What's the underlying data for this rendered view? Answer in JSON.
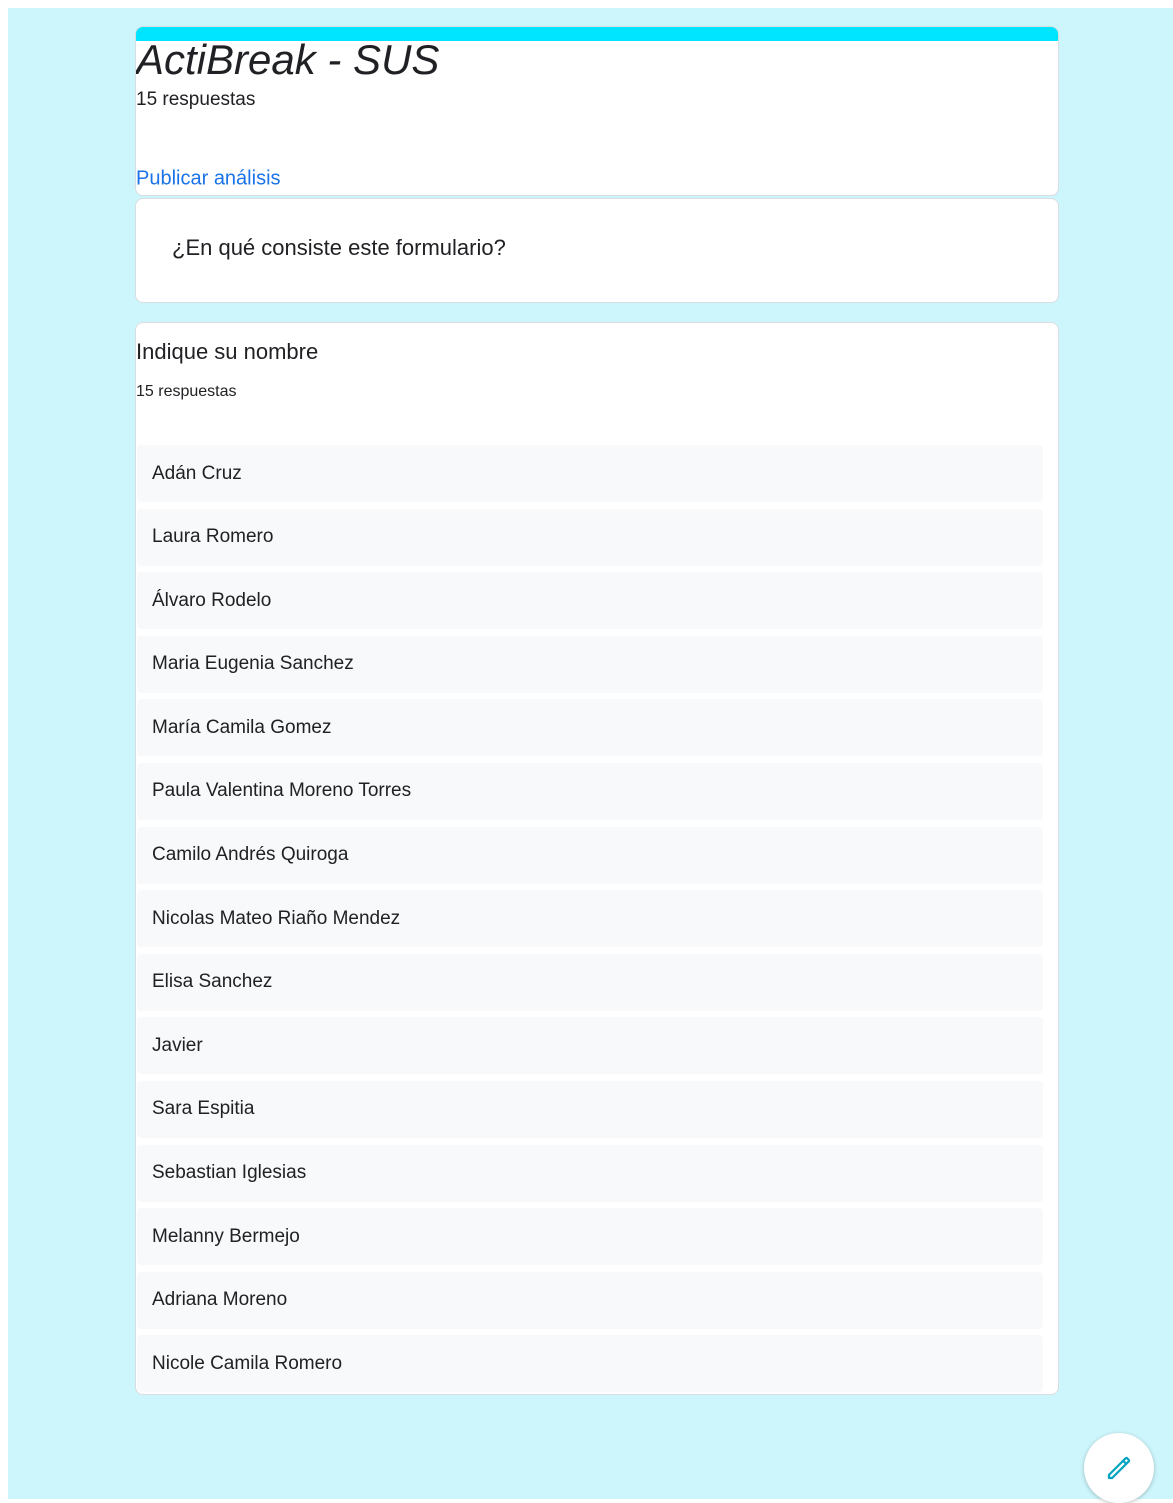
{
  "colors": {
    "accent": "#00e5ff",
    "background": "#cdf6fc",
    "link": "#1a73e8",
    "fab_icon": "#00a3bf"
  },
  "header": {
    "title": "ActiBreak - SUS",
    "responses": "15 respuestas",
    "publish_label": "Publicar análisis"
  },
  "description": {
    "text": "¿En qué consiste este formulario?"
  },
  "question": {
    "title": "Indique su nombre",
    "responses": "15 respuestas",
    "answers": [
      "Adán Cruz",
      "Laura Romero",
      "Álvaro Rodelo",
      "Maria Eugenia Sanchez",
      "María Camila Gomez",
      "Paula Valentina Moreno Torres",
      "Camilo Andrés Quiroga",
      "Nicolas Mateo Riaño Mendez",
      "Elisa Sanchez",
      "Javier",
      "Sara Espitia",
      "Sebastian Iglesias",
      "Melanny Bermejo",
      "Adriana Moreno",
      "Nicole Camila Romero"
    ]
  },
  "fab": {
    "icon": "pencil-icon"
  }
}
